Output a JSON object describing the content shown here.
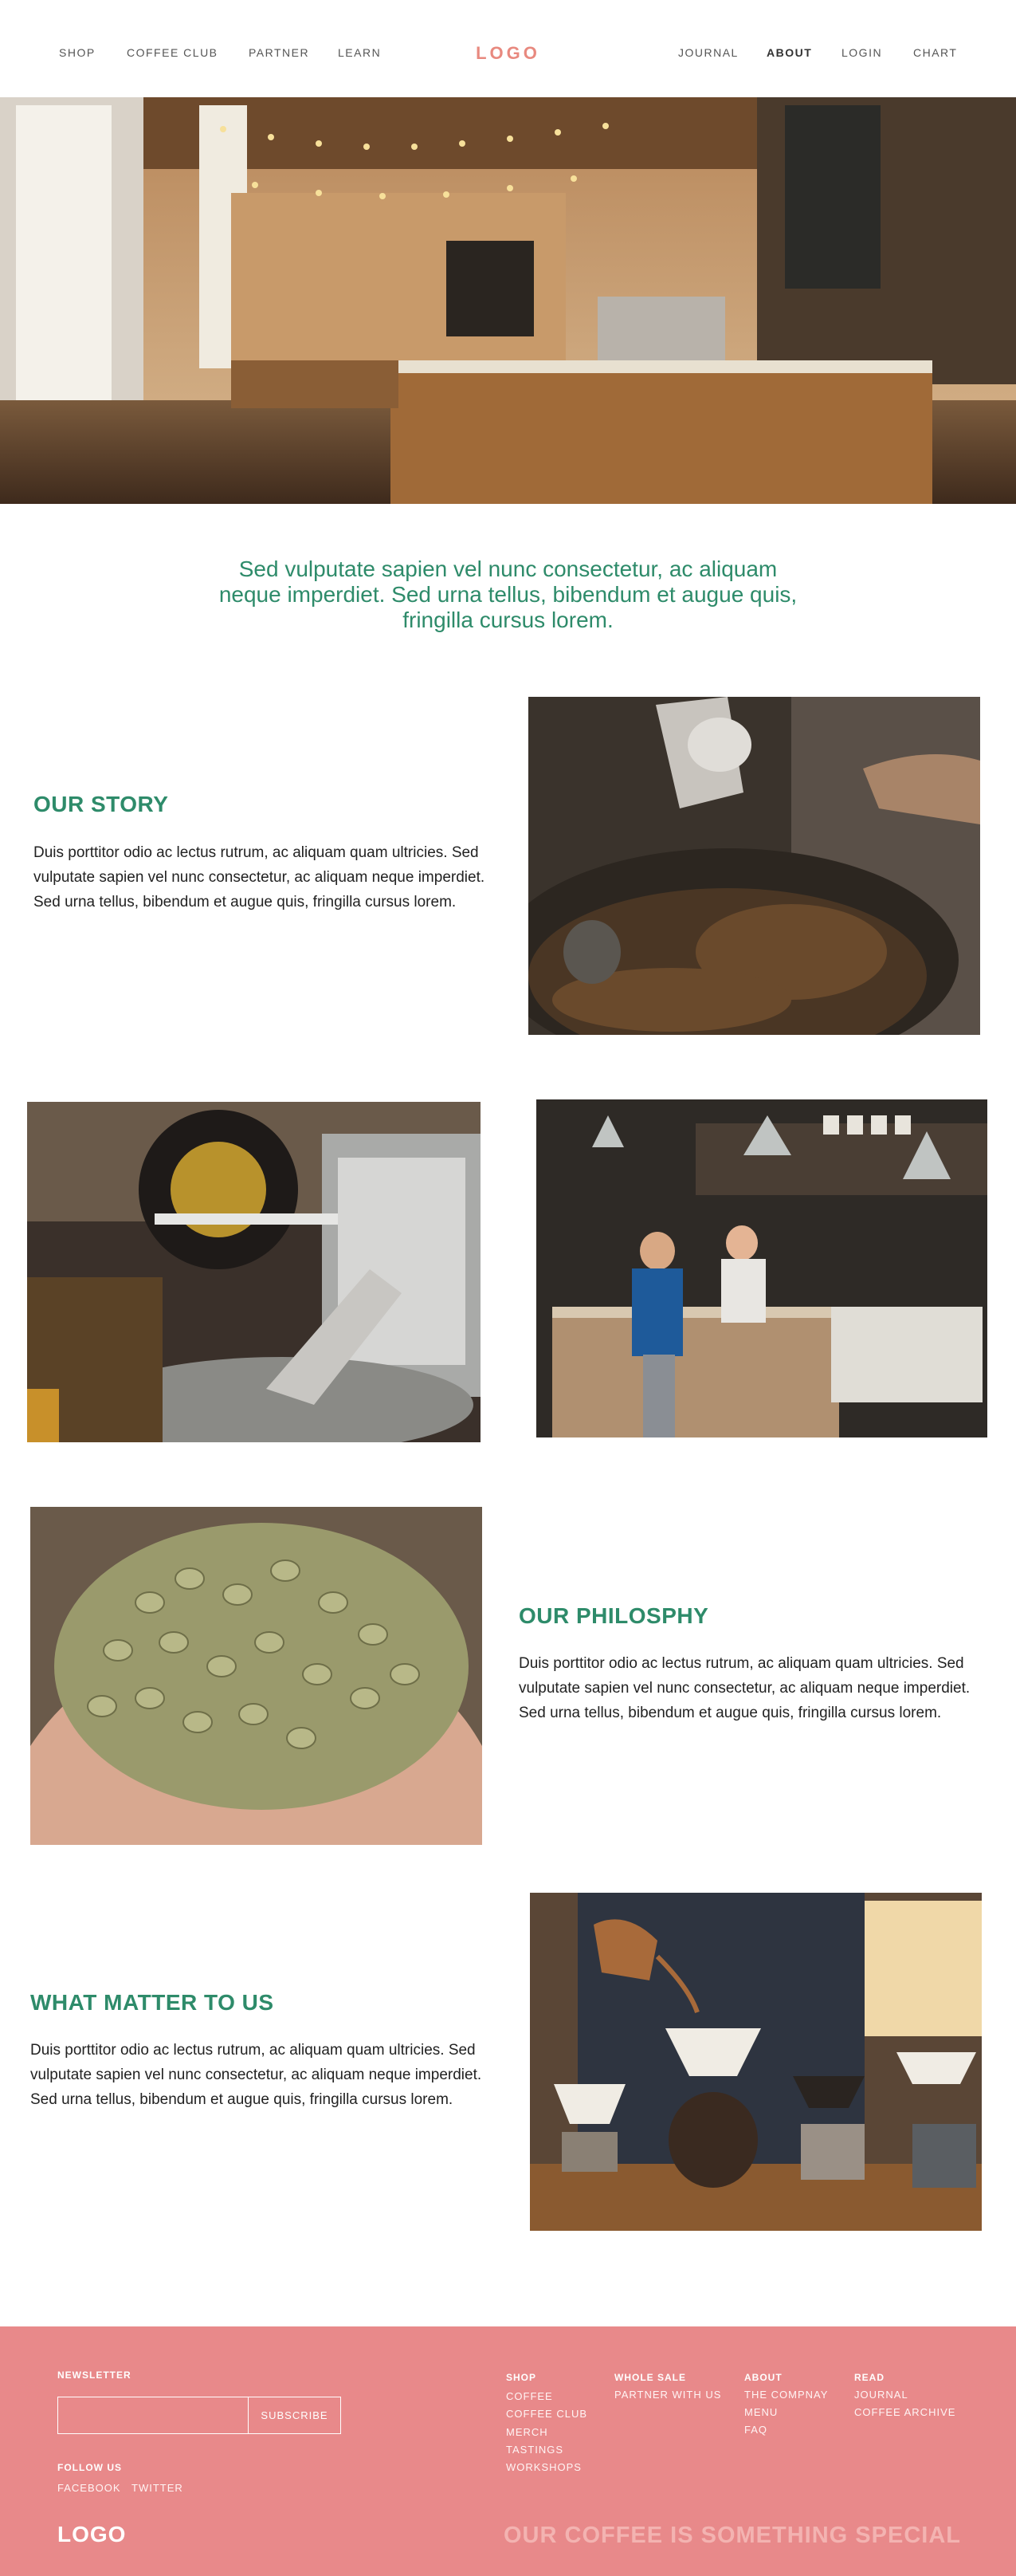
{
  "header": {
    "nav_left": [
      "SHOP",
      "COFFEE CLUB",
      "PARTNER",
      "LEARN"
    ],
    "logo": "LOGO",
    "nav_right": [
      "JOURNAL",
      "ABOUT",
      "LOGIN",
      "CHART"
    ],
    "active": "ABOUT"
  },
  "intro": {
    "text": "Sed vulputate sapien vel nunc consectetur, ac aliquam neque imperdiet. Sed urna tellus, bibendum et augue quis, fringilla cursus lorem."
  },
  "sections": [
    {
      "title": "OUR STORY",
      "body": "Duis porttitor odio ac lectus rutrum, ac aliquam quam ultricies. Sed vulputate sapien vel nunc consectetur, ac aliquam neque imperdiet. Sed urna tellus, bibendum et augue quis, fringilla cursus lorem."
    },
    {
      "title": "OUR PHILOSPHY",
      "body": "Duis porttitor odio ac lectus rutrum, ac aliquam quam ultricies. Sed vulputate sapien vel nunc consectetur, ac aliquam neque imperdiet. Sed urna tellus, bibendum et augue quis, fringilla cursus lorem."
    },
    {
      "title": "WHAT MATTER TO US",
      "body": "Duis porttitor odio ac lectus rutrum, ac aliquam quam ultricies. Sed vulputate sapien vel nunc consectetur, ac aliquam neque imperdiet. Sed urna tellus, bibendum et augue quis, fringilla cursus lorem."
    }
  ],
  "footer": {
    "newsletter_label": "NEWSLETTER",
    "newsletter_placeholder": "",
    "subscribe_label": "SUBSCRIBE",
    "follow_label": "FOLLOW US",
    "social": [
      "FACEBOOK",
      "TWITTER"
    ],
    "logo": "LOGO",
    "tagline": "OUR COFFEE IS SOMETHING SPECIAL",
    "columns": [
      {
        "title": "SHOP",
        "links": [
          "COFFEE",
          "COFFEE CLUB",
          "MERCH",
          "TASTINGS",
          "WORKSHOPS"
        ]
      },
      {
        "title": "WHOLE SALE",
        "links": [
          "PARTNER WITH US"
        ]
      },
      {
        "title": "ABOUT",
        "links": [
          "THE COMPNAY",
          "MENU",
          "FAQ"
        ]
      },
      {
        "title": "READ",
        "links": [
          "JOURNAL",
          "COFFEE ARCHIVE"
        ]
      }
    ]
  },
  "colors": {
    "accent_green": "#2e8b6a",
    "logo_pink": "#e8897f",
    "footer_pink": "#e8898a"
  }
}
